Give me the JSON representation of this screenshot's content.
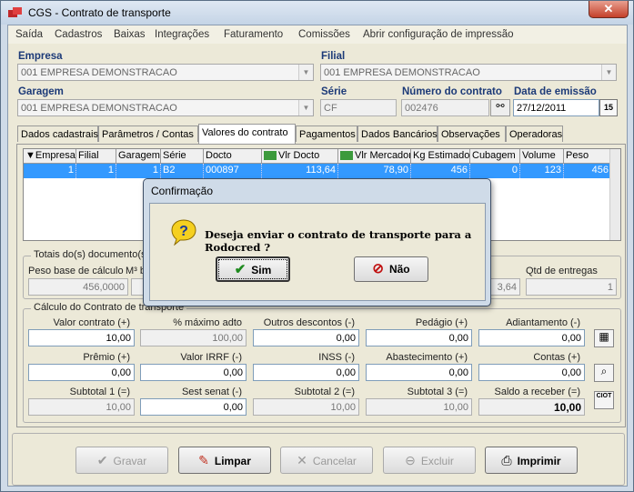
{
  "window": {
    "title": "CGS - Contrato de transporte",
    "close": "✕"
  },
  "menu": [
    "Saída",
    "Cadastros",
    "Baixas",
    "Integrações",
    "Faturamento",
    "Comissões",
    "Abrir configuração de impressão"
  ],
  "header": {
    "empresa_label": "Empresa",
    "empresa_value": "001 EMPRESA DEMONSTRACAO",
    "filial_label": "Filial",
    "filial_value": "001 EMPRESA DEMONSTRACAO",
    "garagem_label": "Garagem",
    "garagem_value": "001 EMPRESA DEMONSTRACAO",
    "serie_label": "Série",
    "serie_value": "CF",
    "numero_label": "Número do contrato",
    "numero_value": "002476",
    "data_label": "Data de emissão",
    "data_value": "27/12/2011",
    "cal_icon": "15"
  },
  "tabs": [
    "Dados cadastrais",
    "Parâmetros / Contas",
    "Valores do contrato",
    "Pagamentos",
    "Dados Bancários",
    "Observações",
    "Operadoras"
  ],
  "grid": {
    "columns": [
      "Empresa",
      "Filial",
      "Garagem",
      "Série",
      "Docto",
      "Vlr Docto",
      "Vlr Mercadoria",
      "Kg Estimado",
      "Cubagem",
      "Volume",
      "Peso"
    ],
    "row": [
      "1",
      "1",
      "1",
      "B2",
      "000897",
      "113,64",
      "78,90",
      "456",
      "0",
      "123",
      "456"
    ]
  },
  "totais": {
    "title": "Totais do(s) documento(s)",
    "peso_label": "Peso base de cálculo",
    "peso_value": "456,0000",
    "m3_label": "M³ b",
    "extra_value": "3,64",
    "qtd_label": "Qtd de entregas",
    "qtd_value": "1"
  },
  "calculo": {
    "title": "Cálculo do Contrato de transporte",
    "row1": [
      {
        "label": "Valor contrato (+)",
        "value": "10,00"
      },
      {
        "label": "% máximo adto",
        "value": "100,00"
      },
      {
        "label": "Outros descontos (-)",
        "value": "0,00"
      },
      {
        "label": "Pedágio (+)",
        "value": "0,00"
      },
      {
        "label": "Adiantamento (-)",
        "value": "0,00"
      }
    ],
    "row2": [
      {
        "label": "Prêmio (+)",
        "value": "0,00"
      },
      {
        "label": "Valor IRRF (-)",
        "value": "0,00"
      },
      {
        "label": "INSS (-)",
        "value": "0,00"
      },
      {
        "label": "Abastecimento (+)",
        "value": "0,00"
      },
      {
        "label": "Contas (+)",
        "value": "0,00"
      }
    ],
    "row3": [
      {
        "label": "Subtotal 1 (=)",
        "value": "10,00"
      },
      {
        "label": "Sest senat (-)",
        "value": "0,00"
      },
      {
        "label": "Subtotal 2 (=)",
        "value": "10,00"
      },
      {
        "label": "Subtotal 3 (=)",
        "value": "10,00"
      },
      {
        "label": "Saldo a receber (=)",
        "value": "10,00"
      }
    ],
    "ciot_label": "CIOT"
  },
  "buttons": {
    "gravar": "Gravar",
    "limpar": "Limpar",
    "cancelar": "Cancelar",
    "excluir": "Excluir",
    "imprimir": "Imprimir"
  },
  "dialog": {
    "title": "Confirmação",
    "message": "Deseja enviar o contrato de transporte para a Rodocred ?",
    "yes": "Sim",
    "no": "Não"
  }
}
